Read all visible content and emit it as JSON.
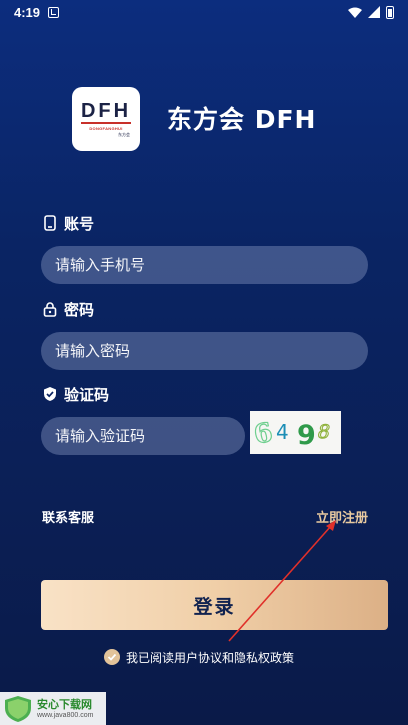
{
  "status_bar": {
    "time": "4:19"
  },
  "brand": {
    "logo_mark": "DFH",
    "logo_sub_en": "DONGFANGHUI",
    "logo_sub_cn": "东方会",
    "title": "东方会  DFH",
    "accent_color": "#e8c9a0",
    "logo_red": "#c8302a"
  },
  "form": {
    "account": {
      "label": "账号",
      "placeholder": "请输入手机号",
      "icon": "phone-icon"
    },
    "password": {
      "label": "密码",
      "placeholder": "请输入密码",
      "icon": "lock-icon"
    },
    "captcha": {
      "label": "验证码",
      "placeholder": "请输入验证码",
      "icon": "shield-check-icon",
      "code": "6498"
    }
  },
  "links": {
    "contact": "联系客服",
    "register": "立即注册"
  },
  "login_button": "登录",
  "agreement": {
    "text": "我已阅读用户协议和隐私权政策",
    "checked": true
  },
  "watermark": {
    "title": "安心下载网",
    "url": "www.java800.com"
  }
}
